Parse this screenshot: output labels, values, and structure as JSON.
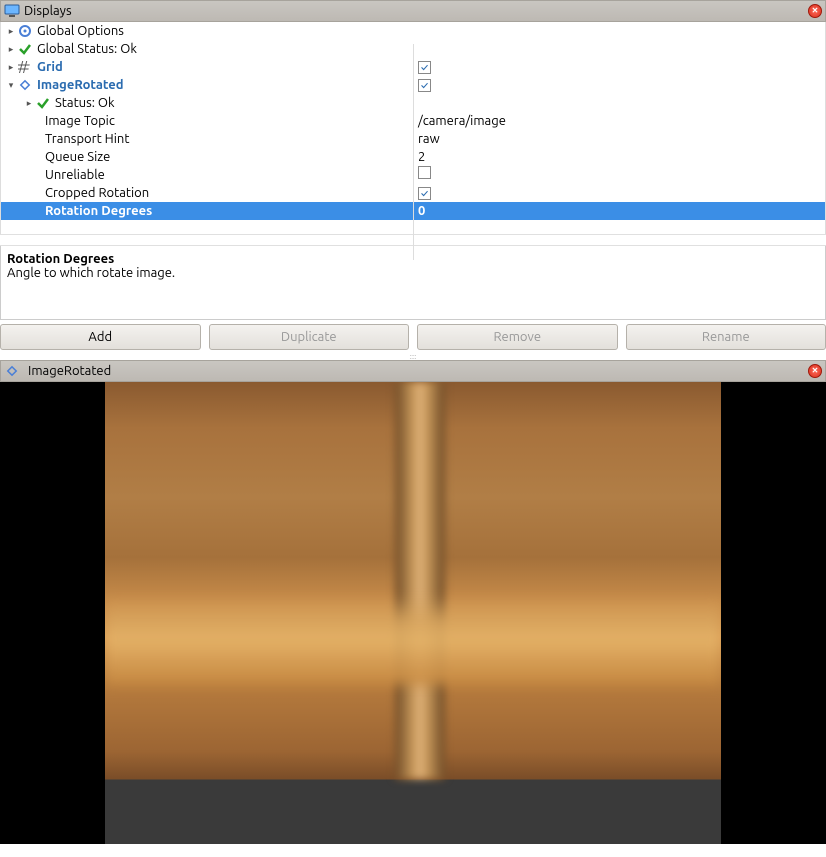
{
  "displays_panel": {
    "title": "Displays",
    "tree": {
      "global_options": {
        "label": "Global Options"
      },
      "global_status": {
        "label": "Global Status: Ok"
      },
      "grid": {
        "label": "Grid",
        "checked": true
      },
      "image_rotated": {
        "label": "ImageRotated",
        "checked": true,
        "status": {
          "label": "Status: Ok"
        },
        "props": {
          "image_topic": {
            "label": "Image Topic",
            "value": "/camera/image"
          },
          "transport_hint": {
            "label": "Transport Hint",
            "value": "raw"
          },
          "queue_size": {
            "label": "Queue Size",
            "value": "2"
          },
          "unreliable": {
            "label": "Unreliable",
            "checked": false
          },
          "cropped_rotation": {
            "label": "Cropped Rotation",
            "checked": true
          },
          "rotation_degrees": {
            "label": "Rotation Degrees",
            "value": "0"
          }
        }
      }
    },
    "description": {
      "title": "Rotation Degrees",
      "text": "Angle to which rotate image."
    },
    "buttons": {
      "add": "Add",
      "duplicate": "Duplicate",
      "remove": "Remove",
      "rename": "Rename"
    }
  },
  "image_panel": {
    "title": "ImageRotated"
  }
}
